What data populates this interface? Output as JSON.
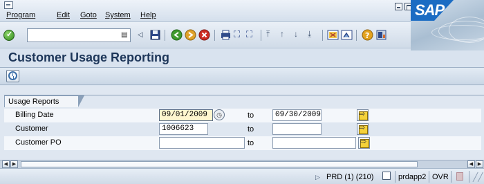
{
  "menu": {
    "items": [
      "Program",
      "Edit",
      "Goto",
      "System",
      "Help"
    ]
  },
  "toolbar": {
    "command_value": "",
    "icons": [
      "enter-icon",
      "back-icon",
      "save-icon",
      "back-nav-icon",
      "exit-icon",
      "cancel-icon",
      "print-icon",
      "find-icon",
      "find-next-icon",
      "first-page-icon",
      "prev-page-icon",
      "next-page-icon",
      "last-page-icon",
      "create-session-icon",
      "shortcut-icon",
      "help-icon",
      "layout-icon"
    ]
  },
  "brand": {
    "logo_text": "SAP"
  },
  "page": {
    "title": "Customer Usage Reporting"
  },
  "app_toolbar": {
    "execute_icon": "execute-clock-icon"
  },
  "group": {
    "title": "Usage Reports",
    "to_label": "to",
    "rows": [
      {
        "label": "Billing Date",
        "from": "09/01/2009",
        "to": "09/30/2009"
      },
      {
        "label": "Customer",
        "from": "1006623",
        "to": ""
      },
      {
        "label": "Customer PO",
        "from": "",
        "to": ""
      }
    ]
  },
  "status": {
    "system": "PRD (1) (210)",
    "server": "prdapp2",
    "mode": "OVR"
  },
  "colors": {
    "title": "#1d3659",
    "background": "#dfe7f1",
    "focused_field": "#fff6cf"
  }
}
